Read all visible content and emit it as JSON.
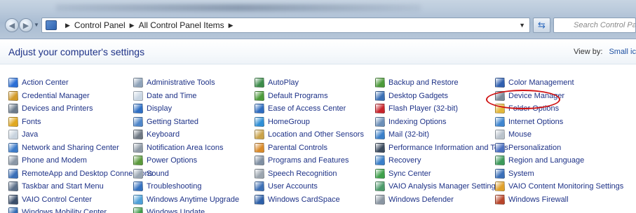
{
  "address": {
    "crumbs": [
      "Control Panel",
      "All Control Panel Items"
    ]
  },
  "search": {
    "placeholder": "Search Control Panel"
  },
  "header": {
    "title": "Adjust your computer's settings",
    "view_by_label": "View by:",
    "view_by_value": "Small ic"
  },
  "items": [
    [
      {
        "label": "Action Center",
        "icon": "flag-icon",
        "color": "#2b6fd6"
      },
      {
        "label": "Credential Manager",
        "icon": "vault-icon",
        "color": "#d29a2a"
      },
      {
        "label": "Devices and Printers",
        "icon": "printer-icon",
        "color": "#6c7b8c"
      },
      {
        "label": "Fonts",
        "icon": "fonts-icon",
        "color": "#e0a820"
      },
      {
        "label": "Java",
        "icon": "java-icon",
        "color": "#c8d3de"
      },
      {
        "label": "Network and Sharing Center",
        "icon": "network-icon",
        "color": "#3d7cc9"
      },
      {
        "label": "Phone and Modem",
        "icon": "phone-icon",
        "color": "#8a97a6"
      },
      {
        "label": "RemoteApp and Desktop Connections",
        "icon": "remoteapp-icon",
        "color": "#3a6fb8"
      },
      {
        "label": "Taskbar and Start Menu",
        "icon": "taskbar-icon",
        "color": "#5b6f88"
      },
      {
        "label": "VAIO Control Center",
        "icon": "vaio-icon",
        "color": "#3b4f6b"
      },
      {
        "label": "Windows Mobility Center",
        "icon": "mobility-icon",
        "color": "#2f6ab3"
      }
    ],
    [
      {
        "label": "Administrative Tools",
        "icon": "admin-tools-icon",
        "color": "#8ea2b8"
      },
      {
        "label": "Date and Time",
        "icon": "clock-icon",
        "color": "#c9d6e3"
      },
      {
        "label": "Display",
        "icon": "display-icon",
        "color": "#2f6fc4"
      },
      {
        "label": "Getting Started",
        "icon": "getting-started-icon",
        "color": "#4f86c9"
      },
      {
        "label": "Keyboard",
        "icon": "keyboard-icon",
        "color": "#6e7782"
      },
      {
        "label": "Notification Area Icons",
        "icon": "notification-icon",
        "color": "#8f9aa6"
      },
      {
        "label": "Power Options",
        "icon": "power-icon",
        "color": "#5b9a3c"
      },
      {
        "label": "Sound",
        "icon": "speaker-icon",
        "color": "#9aa6b2"
      },
      {
        "label": "Troubleshooting",
        "icon": "troubleshoot-icon",
        "color": "#3571bf"
      },
      {
        "label": "Windows Anytime Upgrade",
        "icon": "upgrade-icon",
        "color": "#4ea0d8"
      },
      {
        "label": "Windows Update",
        "icon": "update-icon",
        "color": "#3f9a4a"
      }
    ],
    [
      {
        "label": "AutoPlay",
        "icon": "autoplay-icon",
        "color": "#3c8c4a"
      },
      {
        "label": "Default Programs",
        "icon": "default-programs-icon",
        "color": "#4c9a3a"
      },
      {
        "label": "Ease of Access Center",
        "icon": "ease-access-icon",
        "color": "#2e6cc0"
      },
      {
        "label": "HomeGroup",
        "icon": "homegroup-icon",
        "color": "#2f8fd6"
      },
      {
        "label": "Location and Other Sensors",
        "icon": "sensors-icon",
        "color": "#c9a24a"
      },
      {
        "label": "Parental Controls",
        "icon": "parental-icon",
        "color": "#d98a2a"
      },
      {
        "label": "Programs and Features",
        "icon": "programs-icon",
        "color": "#7f8fa2"
      },
      {
        "label": "Speech Recognition",
        "icon": "microphone-icon",
        "color": "#9aa4ae"
      },
      {
        "label": "User Accounts",
        "icon": "users-icon",
        "color": "#3c6fb5"
      },
      {
        "label": "Windows CardSpace",
        "icon": "cardspace-icon",
        "color": "#2d5fa8"
      }
    ],
    [
      {
        "label": "Backup and Restore",
        "icon": "backup-icon",
        "color": "#4c9a3a"
      },
      {
        "label": "Desktop Gadgets",
        "icon": "gadgets-icon",
        "color": "#3a6fb5"
      },
      {
        "label": "Flash Player (32-bit)",
        "icon": "flash-icon",
        "color": "#c8232b"
      },
      {
        "label": "Indexing Options",
        "icon": "indexing-icon",
        "color": "#6b8fb8"
      },
      {
        "label": "Mail (32-bit)",
        "icon": "mail-icon",
        "color": "#3a7fc9"
      },
      {
        "label": "Performance Information and Tools",
        "icon": "performance-icon",
        "color": "#3a4a5e"
      },
      {
        "label": "Recovery",
        "icon": "recovery-icon",
        "color": "#3a7fc9"
      },
      {
        "label": "Sync Center",
        "icon": "sync-icon",
        "color": "#3ea04a"
      },
      {
        "label": "VAIO Analysis Manager Settings",
        "icon": "vaio-analysis-icon",
        "color": "#4c9a6a"
      },
      {
        "label": "Windows Defender",
        "icon": "defender-icon",
        "color": "#8a96a2"
      }
    ],
    [
      {
        "label": "Color Management",
        "icon": "color-management-icon",
        "color": "#2f5fb0"
      },
      {
        "label": "Device Manager",
        "icon": "device-manager-icon",
        "color": "#7c8a99"
      },
      {
        "label": "Folder Options",
        "icon": "folder-icon",
        "color": "#e4b83a"
      },
      {
        "label": "Internet Options",
        "icon": "internet-icon",
        "color": "#3f86d0"
      },
      {
        "label": "Mouse",
        "icon": "mouse-icon",
        "color": "#b9c2cb"
      },
      {
        "label": "Personalization",
        "icon": "personalization-icon",
        "color": "#4a6fc0"
      },
      {
        "label": "Region and Language",
        "icon": "globe-icon",
        "color": "#3c9a5a"
      },
      {
        "label": "System",
        "icon": "system-icon",
        "color": "#3a6fb8"
      },
      {
        "label": "VAIO Content Monitoring Settings",
        "icon": "vaio-content-icon",
        "color": "#e0a02a"
      },
      {
        "label": "Windows Firewall",
        "icon": "firewall-icon",
        "color": "#b8452a"
      }
    ]
  ]
}
